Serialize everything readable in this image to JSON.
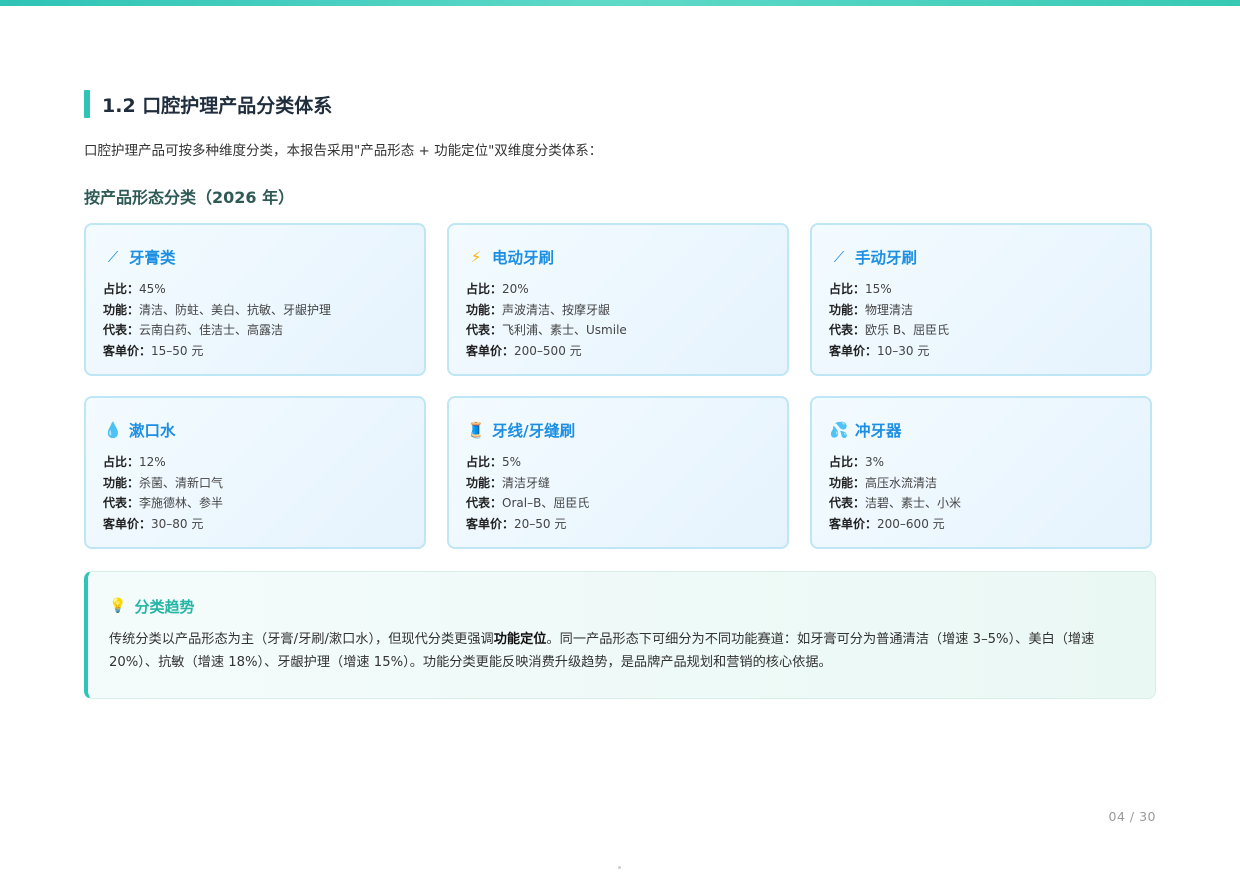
{
  "colors": {
    "accent": "#2ec4b6",
    "card_title": "#1d8fe3",
    "subtitle": "#2e5a56",
    "trend_title": "#25b5a6"
  },
  "section": {
    "title": "1.2 口腔护理产品分类体系"
  },
  "intro": "口腔护理产品可按多种维度分类，本报告采用\"产品形态 + 功能定位\"双维度分类体系：",
  "subtitle": "按产品形态分类（2026 年）",
  "labels": {
    "share": "占比：",
    "function": "功能：",
    "brands": "代表：",
    "price": "客单价："
  },
  "cards": [
    {
      "icon": "toothbrush-icon",
      "glyph": "⟋",
      "name": "牙膏类",
      "share": "45%",
      "function": "清洁、防蛀、美白、抗敏、牙龈护理",
      "brands": "云南白药、佳洁士、高露洁",
      "price": "15–50 元"
    },
    {
      "icon": "lightning-icon",
      "glyph": "⚡",
      "name": "电动牙刷",
      "share": "20%",
      "function": "声波清洁、按摩牙龈",
      "brands": "飞利浦、素士、Usmile",
      "price": "200–500 元"
    },
    {
      "icon": "toothbrush-icon",
      "glyph": "⟋",
      "name": "手动牙刷",
      "share": "15%",
      "function": "物理清洁",
      "brands": "欧乐 B、屈臣氏",
      "price": "10–30 元"
    },
    {
      "icon": "droplet-icon",
      "glyph": "💧",
      "name": "漱口水",
      "share": "12%",
      "function": "杀菌、清新口气",
      "brands": "李施德林、参半",
      "price": "30–80 元"
    },
    {
      "icon": "thread-spool-icon",
      "glyph": "🧵",
      "name": "牙线/牙缝刷",
      "share": "5%",
      "function": "清洁牙缝",
      "brands": "Oral–B、屈臣氏",
      "price": "20–50 元"
    },
    {
      "icon": "water-splash-icon",
      "glyph": "💦",
      "name": "冲牙器",
      "share": "3%",
      "function": "高压水流清洁",
      "brands": "洁碧、素士、小米",
      "price": "200–600 元"
    }
  ],
  "trend": {
    "icon": "lightbulb-icon",
    "glyph": "💡",
    "title": "分类趋势",
    "text_before": "传统分类以产品形态为主（牙膏/牙刷/漱口水），但现代分类更强调",
    "text_bold": "功能定位",
    "text_after": "。同一产品形态下可细分为不同功能赛道：如牙膏可分为普通清洁（增速 3–5%）、美白（增速 20%）、抗敏（增速 18%）、牙龈护理（增速 15%）。功能分类更能反映消费升级趋势，是品牌产品规划和营销的核心依据。"
  },
  "page_number": "04 / 30"
}
